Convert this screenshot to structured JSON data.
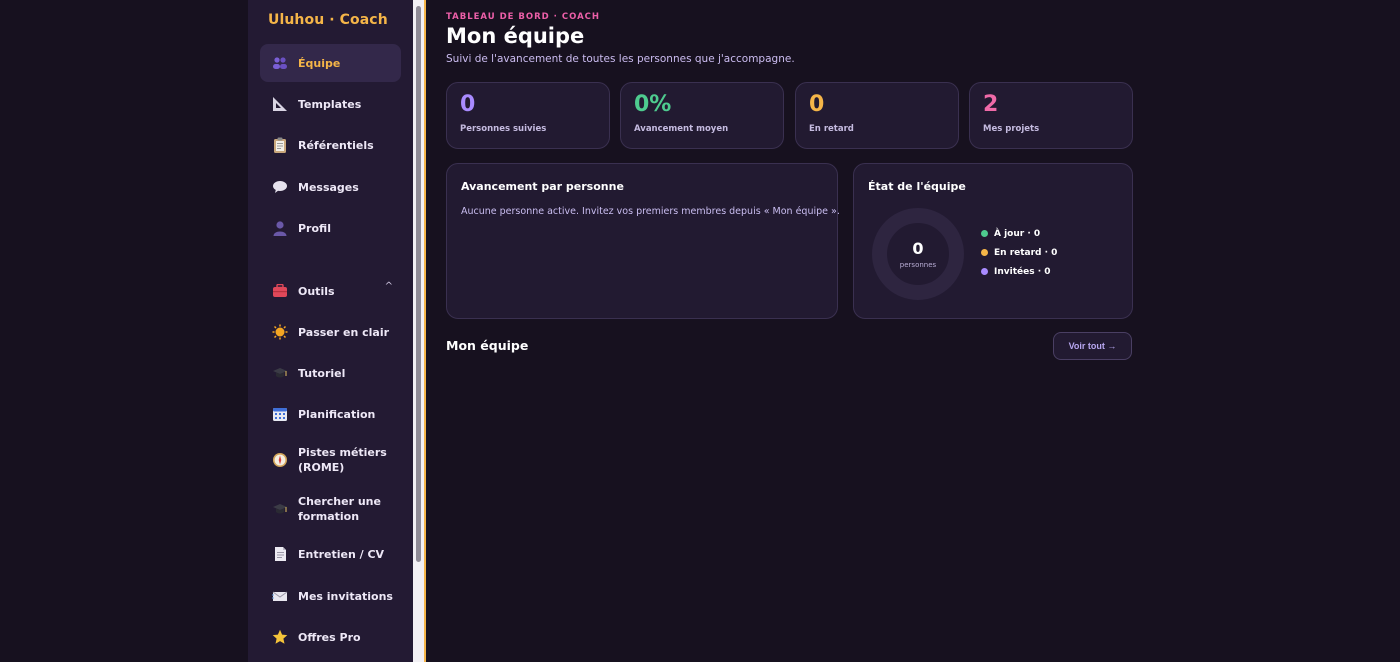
{
  "brand": {
    "title": "Uluhou · Coach",
    "color": "#f5b548"
  },
  "sidebar": {
    "items": [
      {
        "label": "Équipe",
        "icon": "team-icon",
        "active": true
      },
      {
        "label": "Templates",
        "icon": "set-square-icon"
      },
      {
        "label": "Référentiels",
        "icon": "clipboard-icon"
      },
      {
        "label": "Messages",
        "icon": "speech-bubble-icon"
      },
      {
        "label": "Profil",
        "icon": "person-silhouette-icon"
      }
    ],
    "tools": {
      "label": "Outils",
      "icon": "toolbox-icon",
      "chevron": "^",
      "items": [
        {
          "label": "Passer en clair",
          "icon": "sun-icon"
        },
        {
          "label": "Tutoriel",
          "icon": "graduation-cap-icon"
        },
        {
          "label": "Planification",
          "icon": "calendar-icon"
        },
        {
          "label": "Pistes métiers (ROME)",
          "icon": "compass-icon"
        },
        {
          "label": "Chercher une formation",
          "icon": "graduation-cap-icon"
        },
        {
          "label": "Entretien / CV",
          "icon": "document-icon"
        },
        {
          "label": "Mes invitations",
          "icon": "envelope-icon"
        },
        {
          "label": "Offres Pro",
          "icon": "star-icon"
        }
      ]
    }
  },
  "header": {
    "eyebrow": "TABLEAU DE BORD · COACH",
    "title": "Mon équipe",
    "subtitle": "Suivi de l'avancement de toutes les personnes que j'accompagne."
  },
  "kpis": [
    {
      "value": "0",
      "label": "Personnes suivies",
      "color": "#a98bff"
    },
    {
      "value": "0%",
      "label": "Avancement moyen",
      "color": "#4ecb8f"
    },
    {
      "value": "0",
      "label": "En retard",
      "color": "#f5b548"
    },
    {
      "value": "2",
      "label": "Mes projets",
      "color": "#f06aa8"
    }
  ],
  "progress_panel": {
    "title": "Avancement par personne",
    "empty_message": "Aucune personne active. Invitez vos premiers membres depuis « Mon équipe »."
  },
  "team_state": {
    "title": "État de l'équipe",
    "total": "0",
    "total_label": "personnes",
    "legend": [
      {
        "label": "À jour · 0",
        "color": "#4ecb8f"
      },
      {
        "label": "En retard · 0",
        "color": "#f5b548"
      },
      {
        "label": "Invitées · 0",
        "color": "#a98bff"
      }
    ]
  },
  "team_section": {
    "title": "Mon équipe",
    "see_all": "Voir tout →"
  }
}
